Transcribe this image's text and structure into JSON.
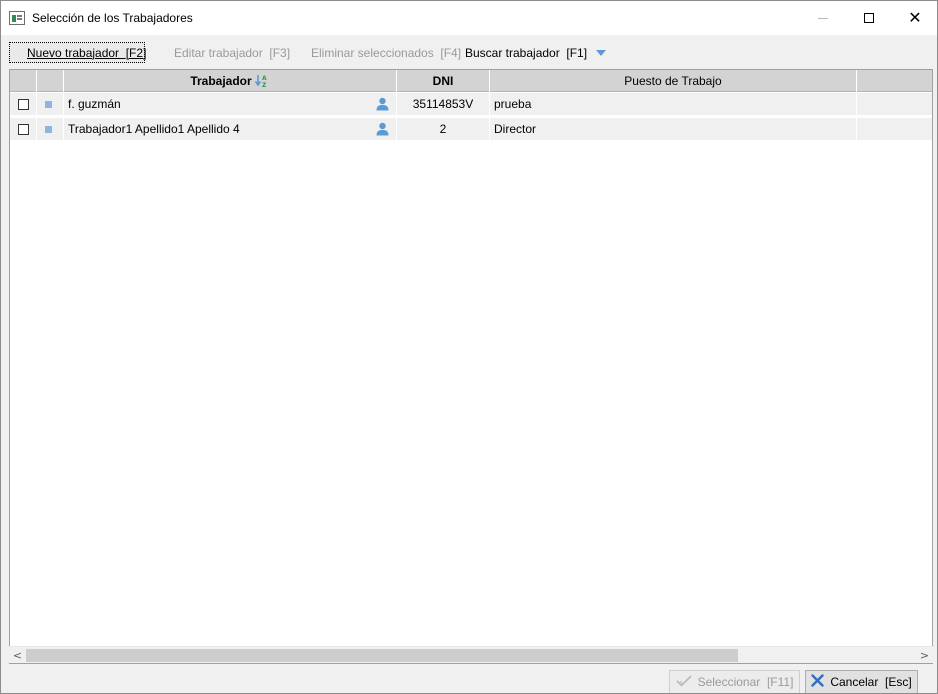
{
  "window": {
    "title": "Selección de los Trabajadores",
    "controls": {
      "minimize": "—",
      "maximize": "☐",
      "close": "✕"
    }
  },
  "toolbar": {
    "new_label": "Nuevo trabajador  [F2]",
    "edit_label": "Editar trabajador  [F3]",
    "delete_label": "Eliminar seleccionados  [F4]",
    "search_label": "Buscar trabajador  [F1]"
  },
  "table": {
    "columns": [
      "",
      "",
      "Trabajador",
      "DNI",
      "Puesto de Trabajo",
      ""
    ],
    "rows": [
      {
        "checked": false,
        "trabajador": "f. guzmán",
        "dni": "35114853V",
        "puesto": "prueba"
      },
      {
        "checked": false,
        "trabajador": "Trabajador1 Apellido1 Apellido 4",
        "dni": "2",
        "puesto": "Director"
      }
    ]
  },
  "scrollbar": {
    "left_arrow": "<",
    "right_arrow": ">"
  },
  "buttons": {
    "select_label": "Seleccionar  [F11]",
    "cancel_label": "Cancelar  [Esc]"
  },
  "colors": {
    "accent": "#5b9bd5",
    "header_bg": "#d3d3d3",
    "row_bg": "#f0f0f0",
    "cancel_icon": "#2f6fc1"
  },
  "icons": {
    "app": "window-app-icon",
    "sort": "sort-az-icon",
    "person": "person-icon",
    "check": "check-icon",
    "cancel": "x-icon"
  }
}
